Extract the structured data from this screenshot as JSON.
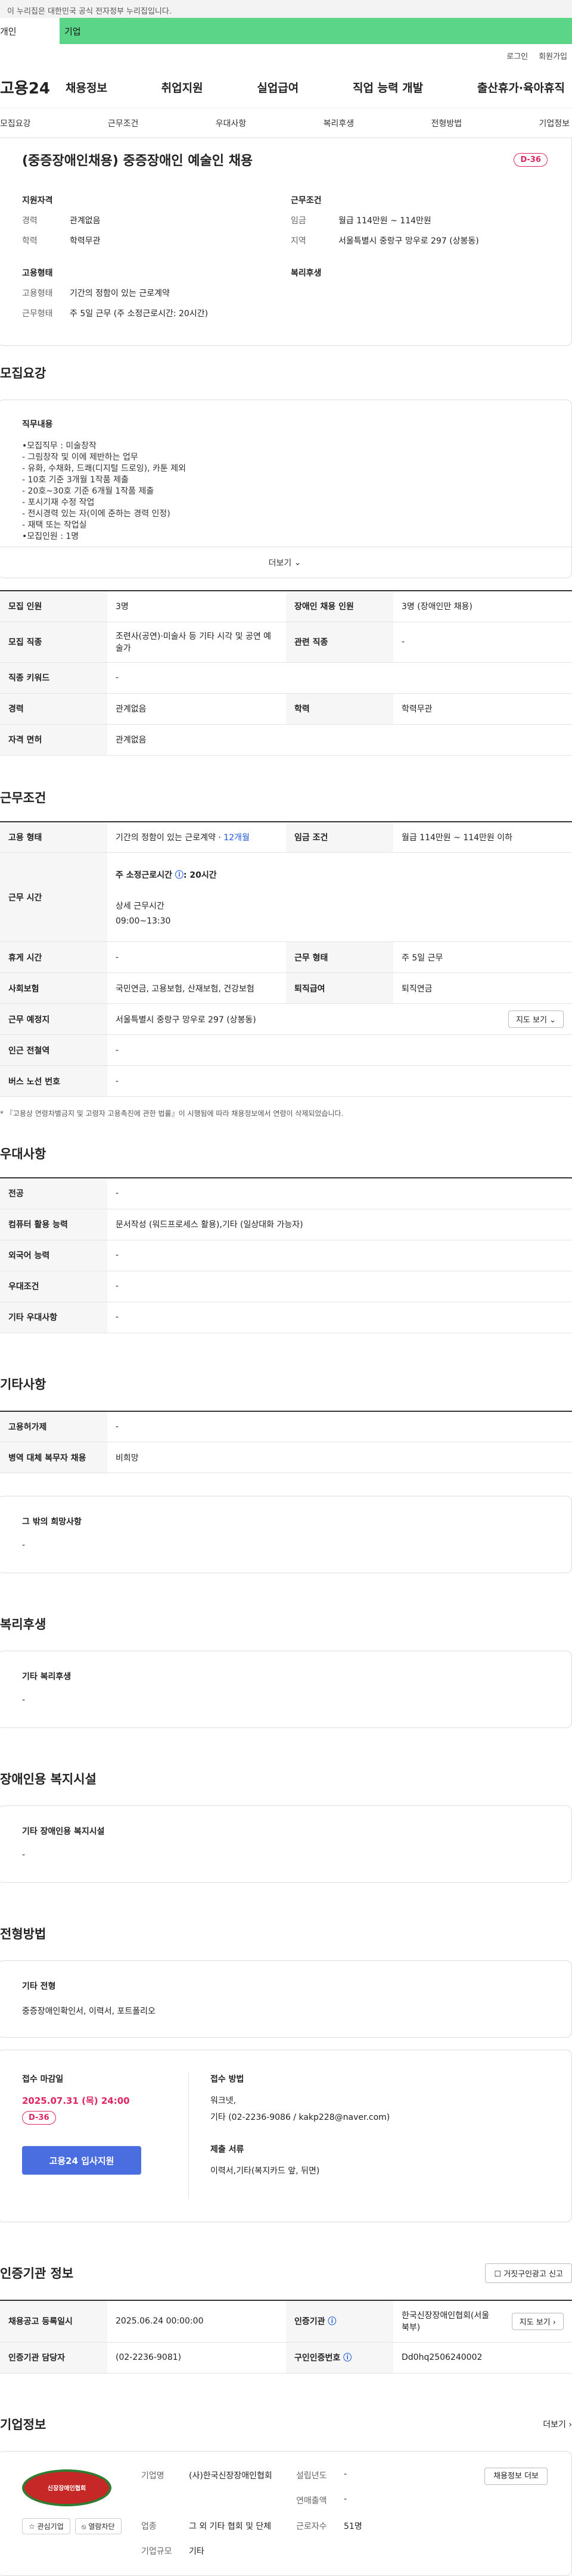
{
  "gov_banner": "이 누리집은 대한민국 공식 전자정부 누리집입니다.",
  "top_tabs": [
    "개인",
    "기업"
  ],
  "util": [
    "로그인",
    "회원가입"
  ],
  "logo": "고용24",
  "gnb": [
    "채용정보",
    "취업지원",
    "실업급여",
    "직업 능력 개발",
    "출산휴가·육아휴직"
  ],
  "subnav": [
    "모집요강",
    "근무조건",
    "우대사항",
    "복리후생",
    "전형방법",
    "기업정보"
  ],
  "summary": {
    "title": "(중증장애인채용) 중증장애인 예술인 채용",
    "dday": "D-36",
    "qual_title": "지원자격",
    "career_k": "경력",
    "career_v": "관계없음",
    "edu_k": "학력",
    "edu_v": "학력무관",
    "cond_title": "근무조건",
    "wage_k": "임금",
    "wage_v": "월급 114만원 ~ 114만원",
    "area_k": "지역",
    "area_v": "서울특별시 중랑구 망우로 297 (상봉동)",
    "emp_title": "고용형태",
    "emptype_k": "고용형태",
    "emptype_v": "기간의 정함이 있는 근로계약",
    "worktype_k": "근무형태",
    "worktype_v": "주 5일 근무 (주 소정근로시간: 20시간)",
    "welfare_title": "복리후생"
  },
  "recruit": {
    "section": "모집요강",
    "duty_title": "직무내용",
    "duty_text": "•모집직무 : 미술창작\n- 그림창작 및 이에 제반하는 업무\n- 유화, 수채화, 드쾌(디지털 드로잉), 카툰 제외\n- 10호 기준 3개월 1작품 제출\n- 20호~30호 기준 6개월 1작품 제출\n- 포시기재 수정 작업\n- 전시경력 있는 자(이에 준하는 경력 인정)\n- 재택 또는 작업실\n•모집인원 : 1명",
    "more": "더보기",
    "rows": [
      {
        "k1": "모집 인원",
        "v1": "3명",
        "k2": "장애인 채용 인원",
        "v2": "3명 (장애인만 채용)"
      },
      {
        "k1": "모집 직종",
        "v1": "조련사(공연)·미술사 등 기타 시각 및 공연 예술가",
        "k2": "관련 직종",
        "v2": "-"
      },
      {
        "k1": "직종 키워드",
        "v1": "-"
      },
      {
        "k1": "경력",
        "v1": "관계없음",
        "k2": "학력",
        "v2": "학력무관"
      },
      {
        "k1": "자격 면허",
        "v1": "관계없음"
      }
    ]
  },
  "work": {
    "section": "근무조건",
    "emp_k": "고용 형태",
    "emp_v": "기간의 정함이 있는 근로계약",
    "emp_months": "12개월",
    "wage_k": "임금 조건",
    "wage_v": "월급 114만원 ~ 114만원 이하",
    "time_k": "근무 시간",
    "time_week": "주 소정근로시간",
    "time_hours": "20시간",
    "time_detail_label": "상세 근무시간",
    "time_detail": "09:00~13:30",
    "break_k": "휴게 시간",
    "break_v": "-",
    "form_k": "근무 형태",
    "form_v": "주 5일 근무",
    "ins_k": "사회보험",
    "ins_v": "국민연금, 고용보험, 산재보험, 건강보험",
    "sev_k": "퇴직급여",
    "sev_v": "퇴직연금",
    "place_k": "근무 예정지",
    "place_v": "서울특별시 중랑구 망우로 297 (상봉동)",
    "map_btn": "지도 보기",
    "subway_k": "인근 전철역",
    "subway_v": "-",
    "bus_k": "버스 노선 번호",
    "bus_v": "-",
    "note": "* 『고용상 연령차별금지 및 고령자 고용촉진에 관한 법률』이 시행됨에 따라 채용정보에서 연령이 삭제되었습니다."
  },
  "pref": {
    "section": "우대사항",
    "rows": [
      {
        "k": "전공",
        "v": "-"
      },
      {
        "k": "컴퓨터 활용 능력",
        "v": "문서작성 (워드프로세스 활용),기타 (일상대화 가능자)"
      },
      {
        "k": "외국어 능력",
        "v": "-"
      },
      {
        "k": "우대조건",
        "v": "-"
      },
      {
        "k": "기타 우대사항",
        "v": "-"
      }
    ]
  },
  "etc": {
    "section": "기타사항",
    "rows": [
      {
        "k": "고용허가제",
        "v": "-"
      },
      {
        "k": "병역 대체 복무자 채용",
        "v": "비희망"
      }
    ],
    "other_title": "그 밖의 희망사항",
    "other_v": "-"
  },
  "welfare": {
    "section": "복리후생",
    "title": "기타 복리후생",
    "v": "-"
  },
  "disabled": {
    "section": "장애인용 복지시설",
    "title": "기타 장애인용 복지시설",
    "v": "-"
  },
  "selection": {
    "section": "전형방법",
    "title": "기타 전형",
    "v": "중증장애인확인서, 이력서, 포트폴리오",
    "deadline_title": "접수 마감일",
    "deadline": "2025.07.31 (목) 24:00",
    "dday": "D-36",
    "apply_btn": "고용24 입사지원",
    "method_title": "접수 방법",
    "method_v1": "워크넷,",
    "method_v2": "기타 (02-2236-9086 / kakp228@naver.com)",
    "docs_title": "제출 서류",
    "docs_v": "이력서,기타(복지카드 앞, 뒤면)"
  },
  "cert": {
    "section": "인증기관 정보",
    "report_btn": "거짓구인광고 신고",
    "reg_k": "채용공고 등록일시",
    "reg_v": "2025.06.24 00:00:00",
    "org_k": "인증기관",
    "org_v": "한국신장장애인협회(서울북부)",
    "map_btn": "지도 보기",
    "contact_k": "인증기관 담당자",
    "contact_v": "(02-2236-9081)",
    "num_k": "구인인증번호",
    "num_v": "Dd0hq2506240002"
  },
  "company": {
    "section": "기업정보",
    "more": "더보기",
    "logo_text": "신장장애인협회",
    "interest_btn": "관심기업",
    "block_btn": "열람차단",
    "name_k": "기업명",
    "name_v": "(사)한국신장장애인협회",
    "year_k": "설립년도",
    "year_v": "-",
    "sales_k": "연매출액",
    "sales_v": "-",
    "industry_k": "업종",
    "industry_v": "그 외 기타 협회 및 단체",
    "staff_k": "근로자수",
    "staff_v": "51명",
    "scale_k": "기업규모",
    "scale_v": "기타",
    "jobs_btn": "채용정보 더보"
  }
}
